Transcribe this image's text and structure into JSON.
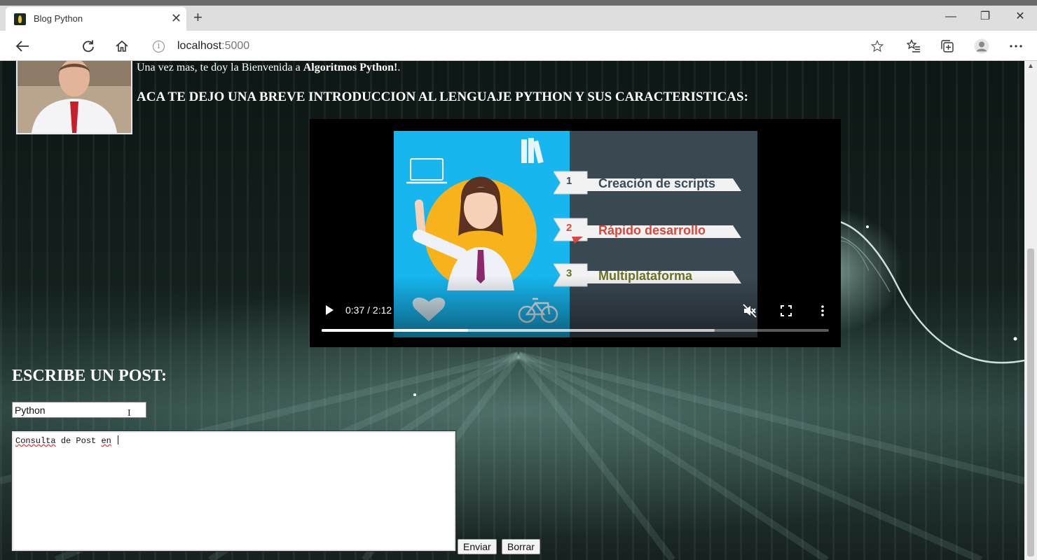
{
  "browser": {
    "tab_title": "Blog Python",
    "tab_close": "✕",
    "new_tab": "+",
    "url_host": "localhost",
    "url_port": ":5000",
    "window_controls": {
      "minimize": "—",
      "restore": "❐",
      "close": "✕"
    }
  },
  "page": {
    "welcome_prefix": "Una vez mas, te doy la Bienvenida a ",
    "welcome_brand": "Algoritmos Python!",
    "welcome_suffix": ".",
    "intro_heading": "ACA TE DEJO UNA BREVE INTRODUCCION AL LENGUAJE PYTHON Y SUS CARACTERISTICAS:"
  },
  "video": {
    "time": "0:37 / 2:12",
    "played_fraction": 0.288,
    "buffered_fraction": 0.775,
    "muted": true,
    "features": [
      {
        "number": "1",
        "label": "Creación de scripts",
        "color": "#3a4a56"
      },
      {
        "number": "2",
        "label": "Rápido desarrollo",
        "color": "#d8473c"
      },
      {
        "number": "3",
        "label": "Multiplataforma",
        "color": "#6b7126"
      }
    ]
  },
  "form": {
    "heading": "ESCRIBE UN POST:",
    "title_value": "Python",
    "body_words": [
      "Consulta",
      "de",
      "Post",
      "en"
    ],
    "submit_label": "Enviar",
    "reset_label": "Borrar"
  }
}
